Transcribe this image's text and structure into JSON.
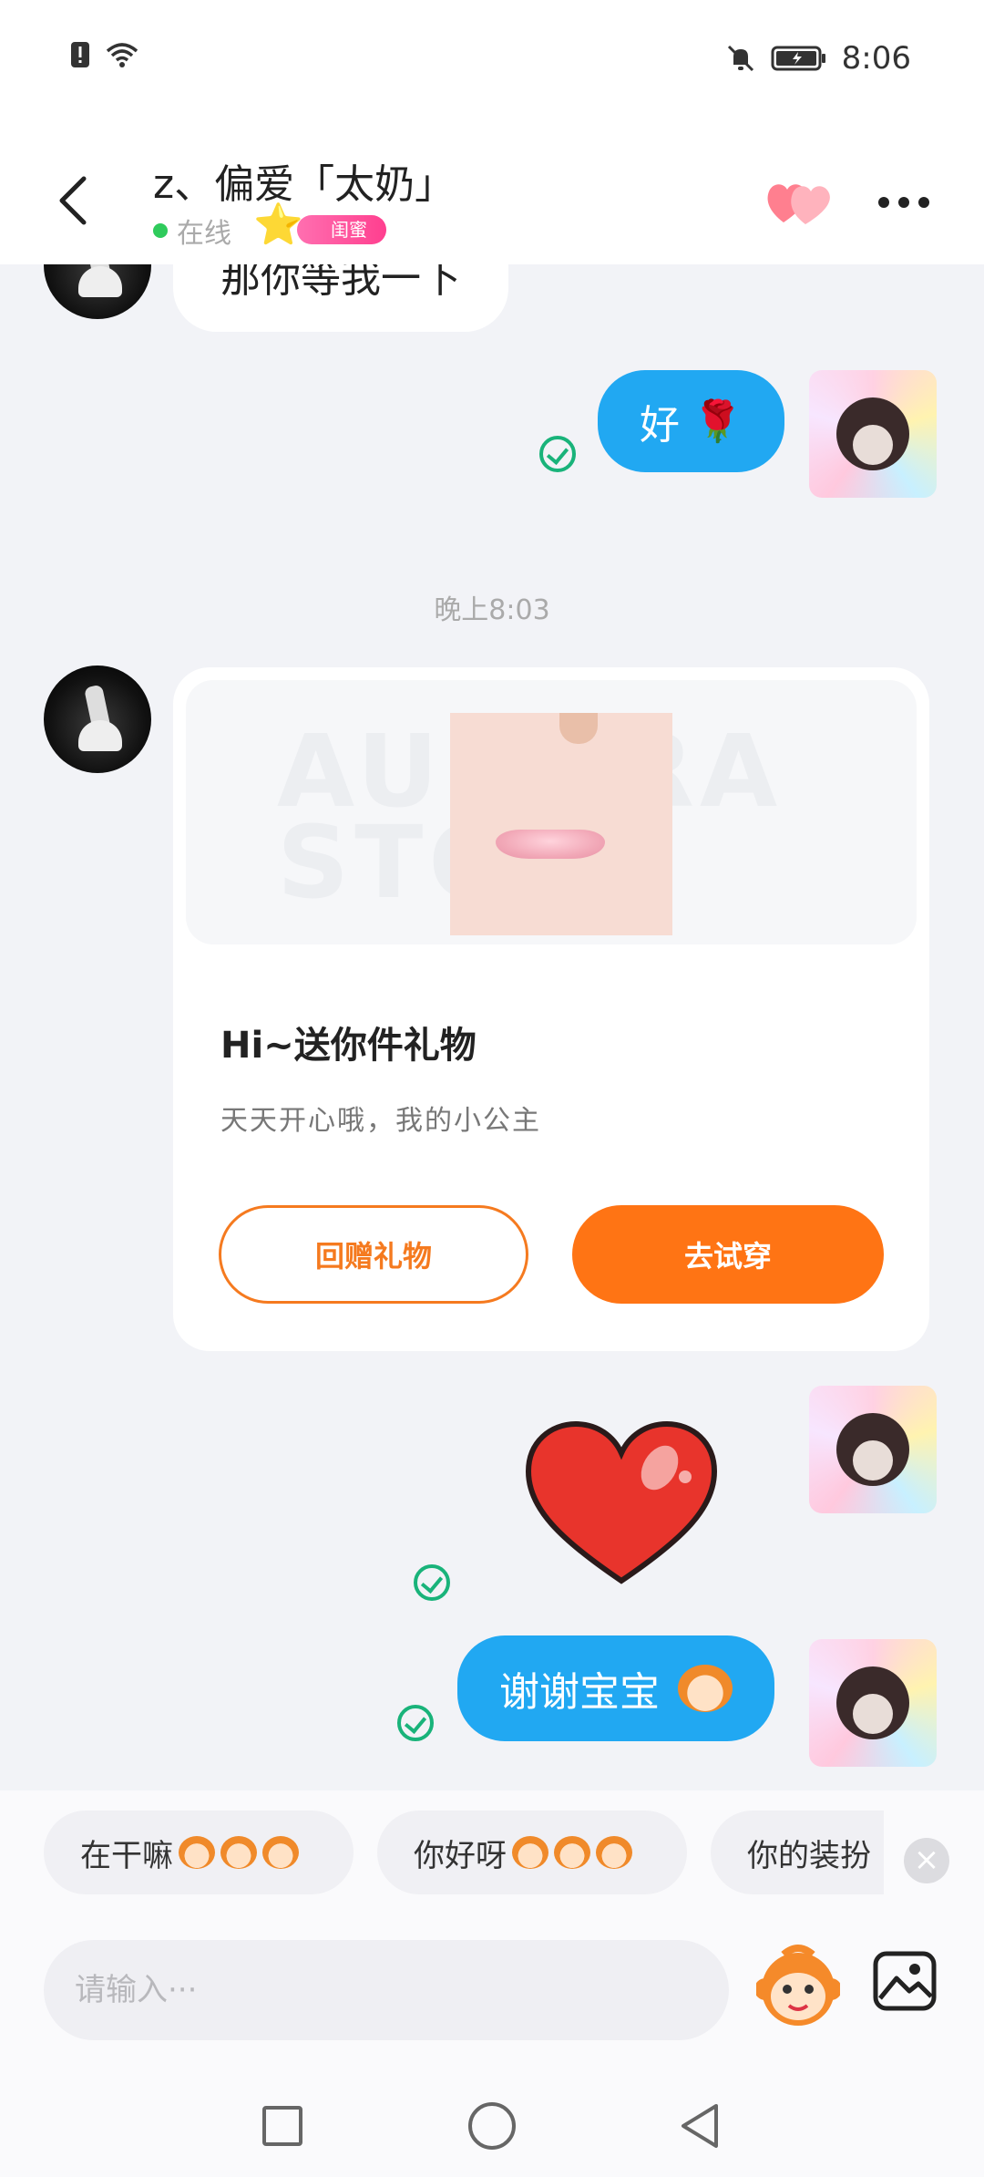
{
  "status_bar": {
    "time": "8:06"
  },
  "header": {
    "contact_name": "z、偏爱「太奶」",
    "online_status": "在线",
    "badge_label": "闺蜜"
  },
  "chat": {
    "messages": [
      {
        "from": "them",
        "text": "那你等我一下"
      },
      {
        "from": "me",
        "text": "好",
        "emoji": "rose-emoji"
      },
      {
        "from": "me",
        "type": "sticker",
        "sticker": "red-heart"
      },
      {
        "from": "me",
        "text": "谢谢宝宝",
        "emoji": "monkey-kiss-emoji"
      }
    ],
    "timestamp": "晚上8:03",
    "gift_card": {
      "watermark": "AURORA STORE",
      "title": "Hi~送你件礼物",
      "subtitle": "天天开心哦，我的小公主",
      "return_gift_label": "回赠礼物",
      "try_on_label": "去试穿"
    }
  },
  "quick_replies": [
    {
      "text": "在干嘛"
    },
    {
      "text": "你好呀"
    },
    {
      "text": "你的装扮"
    }
  ],
  "input": {
    "placeholder": "请输入···"
  },
  "colors": {
    "accent_blue": "#21a8f2",
    "accent_orange": "#ff7414",
    "online_green": "#2fcb5c",
    "read_check": "#19b37a"
  }
}
